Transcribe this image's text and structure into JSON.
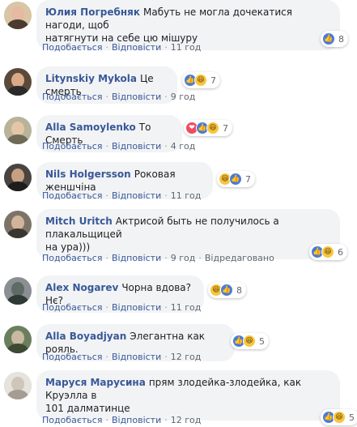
{
  "comments": [
    {
      "author": "Юлия Погребняк",
      "text": "Мабуть не могла дочекатися нагоди, щоб\nнатягнути на себе цю мішуру",
      "like_label": "Подобається",
      "reply_label": "Відповісти",
      "time": "11 год",
      "reactions": [
        "like"
      ],
      "reaction_count": "8",
      "avatar_colors": [
        "#d9c6a6",
        "#e7b9a0",
        "#4b3b2f"
      ]
    },
    {
      "author": "Litynskiy Mykola",
      "text": "Це смерть",
      "like_label": "Подобається",
      "reply_label": "Відповісти",
      "time": "9 год",
      "reactions": [
        "like",
        "haha"
      ],
      "reaction_count": "7",
      "avatar_colors": [
        "#5b4a3a",
        "#d9a988",
        "#2a2a2a"
      ]
    },
    {
      "author": "Alla Samoylenko",
      "text": "То Смерть",
      "like_label": "Подобається",
      "reply_label": "Відповісти",
      "time": "4 год",
      "reactions": [
        "love",
        "like",
        "haha"
      ],
      "reaction_count": "7",
      "avatar_colors": [
        "#b9b39a",
        "#e4c6a6",
        "#6e6a55"
      ]
    },
    {
      "author": "Nils Holgersson",
      "text": "Роковая женшчіна",
      "like_label": "Подобається",
      "reply_label": "Відповісти",
      "time": "11 год",
      "reactions": [
        "haha",
        "like"
      ],
      "reaction_count": "7",
      "avatar_colors": [
        "#4a4440",
        "#c7a082",
        "#1f1d1c"
      ]
    },
    {
      "author": "Mitch Uritch",
      "text": "Актрисой быть не получилось а плакальщицей\nна ура)))",
      "like_label": "Подобається",
      "reply_label": "Відповісти",
      "time": "9 год",
      "edited_label": "Відредаговано",
      "reactions": [
        "like",
        "haha"
      ],
      "reaction_count": "6",
      "avatar_colors": [
        "#7d7468",
        "#d3b49a",
        "#3a3530"
      ]
    },
    {
      "author": "Alex Nogarev",
      "text": "Чорна вдова? Нє?",
      "like_label": "Подобається",
      "reply_label": "Відповісти",
      "time": "11 год",
      "reactions": [
        "haha",
        "like"
      ],
      "reaction_count": "8",
      "avatar_colors": [
        "#8a8f94",
        "#5e6a63",
        "#2f3a35"
      ]
    },
    {
      "author": "Alla Boyadjyan",
      "text": "Элегантна как рояль.",
      "like_label": "Подобається",
      "reply_label": "Відповісти",
      "time": "12 год",
      "reactions": [
        "like",
        "haha"
      ],
      "reaction_count": "5",
      "avatar_colors": [
        "#6b7f5e",
        "#c9b9a0",
        "#3d4a33"
      ]
    },
    {
      "author": "Маруся Марусина",
      "text": "прям злодейка-злодейка, как Круэлла в\n101 далматинце",
      "like_label": "Подобається",
      "reply_label": "Відповісти",
      "time": "12 год",
      "reactions": [
        "like",
        "haha"
      ],
      "reaction_count": "5",
      "avatar_colors": [
        "#e6e2dc",
        "#cfc6bb",
        "#a59c92"
      ]
    }
  ]
}
